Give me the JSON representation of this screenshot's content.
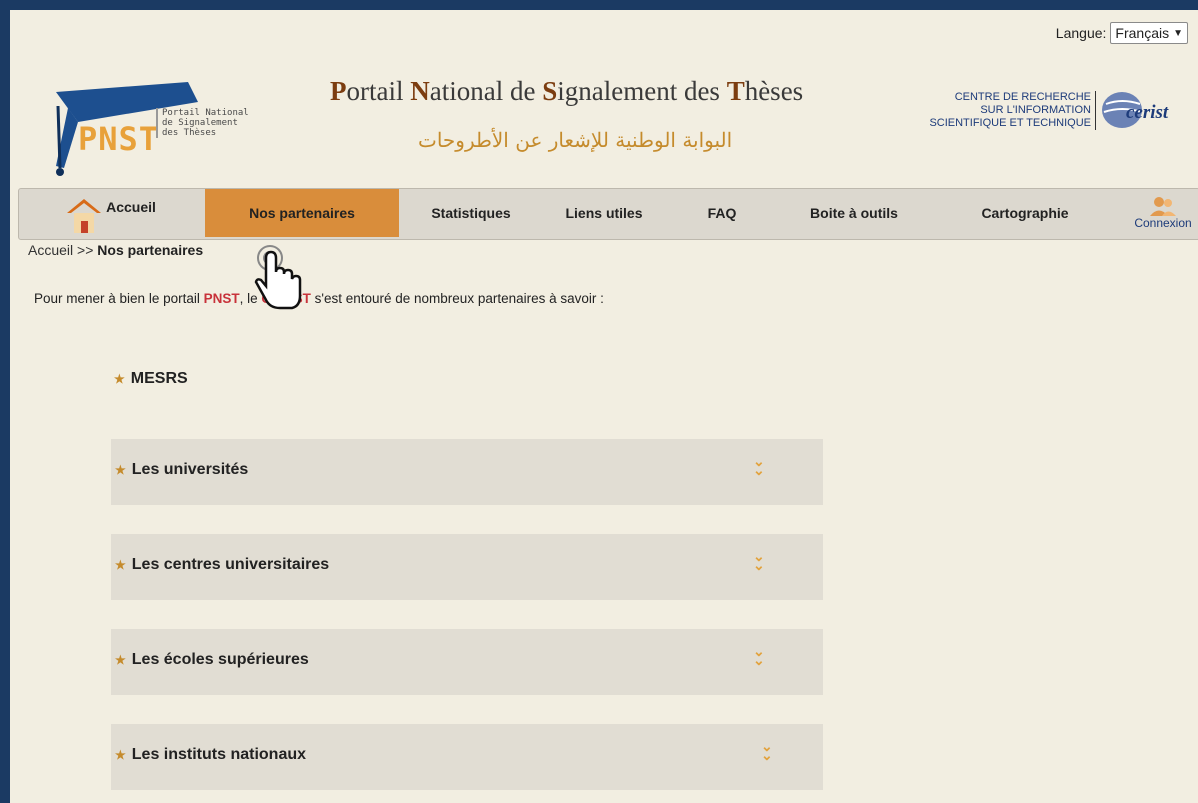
{
  "header": {
    "lang_label": "Langue:",
    "lang_value": "Français",
    "logo_text": "PNST",
    "logo_sub": [
      "Portail National",
      "de  Signalement",
      "des      Thèses"
    ],
    "title_parts": [
      {
        "cap": "P",
        "rest": "ortail "
      },
      {
        "cap": "N",
        "rest": "ational de "
      },
      {
        "cap": "S",
        "rest": "ignalement des "
      },
      {
        "cap": "T",
        "rest": "hèses"
      }
    ],
    "title_ar": "البوابة الوطنية للإشعار عن الأطروحات",
    "cerist_lines": [
      "CENTRE DE RECHERCHE",
      "SUR L'INFORMATION",
      "SCIENTIFIQUE ET TECHNIQUE"
    ],
    "cerist_word": "cerist"
  },
  "nav": {
    "items": [
      {
        "label": "Accueil"
      },
      {
        "label": "Nos partenaires"
      },
      {
        "label": "Statistiques"
      },
      {
        "label": "Liens utiles"
      },
      {
        "label": "FAQ"
      },
      {
        "label": "Boite à outils"
      },
      {
        "label": "Cartographie"
      }
    ],
    "connexion": "Connexion"
  },
  "breadcrumb": {
    "home": "Accueil",
    "sep": ">>",
    "current": "Nos partenaires"
  },
  "intro": {
    "pre": "Pour mener à bien le portail ",
    "pnst": "PNST",
    "mid": ", le ",
    "cerist": "CERIST",
    "post": " s'est entouré de nombreux partenaires à savoir :"
  },
  "partners": {
    "mesrs": "MESRS",
    "sections": [
      {
        "label": "Les universités"
      },
      {
        "label": "Les centres universitaires"
      },
      {
        "label": "Les écoles supérieures"
      },
      {
        "label": "Les instituts nationaux"
      }
    ]
  },
  "colors": {
    "accent": "#d98d3b",
    "frame": "#1b3a63",
    "background": "#f2eee1"
  }
}
